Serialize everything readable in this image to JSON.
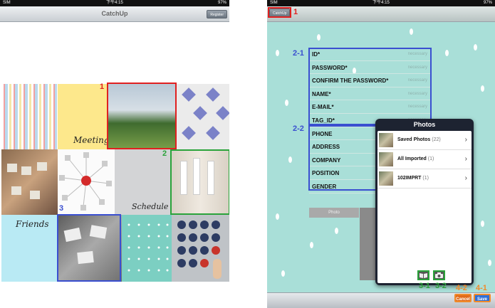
{
  "left": {
    "status": {
      "carrier": "SIM",
      "time": "下午4:15",
      "battery": "97%"
    },
    "title": "CatchUp",
    "register_label": "Register",
    "tiles": {
      "meeting": "Meeting",
      "schedule": "Schedule",
      "friends": "Friends"
    },
    "annotations": {
      "one": "1",
      "two": "2",
      "three": "3"
    }
  },
  "right": {
    "status": {
      "carrier": "SIM",
      "time": "下午4:15",
      "battery": "97%"
    },
    "back_label": "CatchUp",
    "form_fields": [
      {
        "label": "ID*",
        "placeholder": "necessary"
      },
      {
        "label": "PASSWORD*",
        "placeholder": "necessary"
      },
      {
        "label": "CONFIRM THE PASSWORD*",
        "placeholder": "necessary"
      },
      {
        "label": "NAME*",
        "placeholder": "necessary"
      },
      {
        "label": "E-MAIL*",
        "placeholder": "necessary"
      },
      {
        "label": "TAG_ID*",
        "placeholder": "necessary"
      },
      {
        "label": "PHONE",
        "placeholder": ""
      },
      {
        "label": "ADDRESS",
        "placeholder": ""
      },
      {
        "label": "COMPANY",
        "placeholder": ""
      },
      {
        "label": "POSITION",
        "placeholder": ""
      },
      {
        "label": "GENDER",
        "placeholder": ""
      }
    ],
    "photo_label": "Photo",
    "popover": {
      "title": "Photos",
      "items": [
        {
          "name": "Saved Photos",
          "count": "(22)"
        },
        {
          "name": "All Imported",
          "count": "(1)"
        },
        {
          "name": "102IMPRT",
          "count": "(1)"
        }
      ]
    },
    "cancel_label": "Cancel",
    "save_label": "Save",
    "annotations": {
      "a1": "1",
      "a21": "2-1",
      "a22": "2-2",
      "a31": "3-1",
      "a32": "3-2",
      "a41": "4-1",
      "a42": "4-2"
    },
    "colors": {
      "blue": "#3a4fd0",
      "red": "#e02020",
      "green": "#2aa33a",
      "orange": "#f08a2a"
    }
  }
}
